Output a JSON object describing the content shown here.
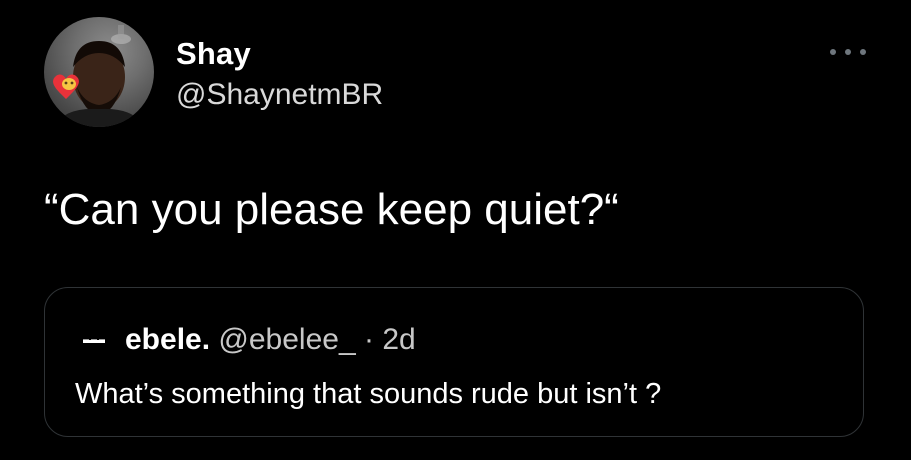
{
  "author": {
    "display_name": "Shay",
    "handle": "@ShaynetmBR",
    "avatar_icon": "profile-photo-with-heart-emoji"
  },
  "tweet": {
    "text": "“Can you please keep quiet?“"
  },
  "menu": {
    "icon": "more-horizontal-icon"
  },
  "quoted_tweet": {
    "display_name": "ebele.",
    "handle": "@ebelee_",
    "separator": "·",
    "time": "2d",
    "text": "What’s something that sounds rude but isn’t ?"
  },
  "colors": {
    "background": "#000000",
    "text_primary": "#ffffff",
    "text_secondary": "#c8c8c8",
    "border": "#2f3336",
    "menu_dots": "#6e767d"
  }
}
